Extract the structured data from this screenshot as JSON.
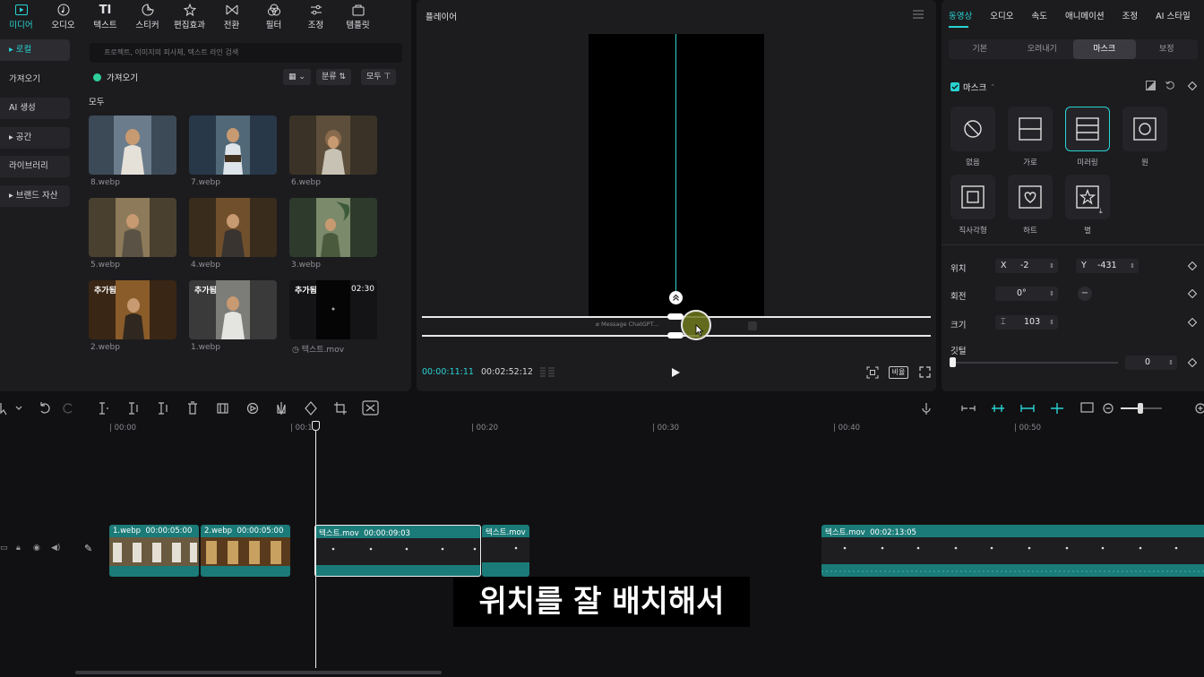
{
  "top_tools": [
    {
      "label": "미디어",
      "icon": "media-icon",
      "active": true
    },
    {
      "label": "오디오",
      "icon": "audio-icon"
    },
    {
      "label": "텍스트",
      "icon": "text-icon"
    },
    {
      "label": "스티커",
      "icon": "sticker-icon"
    },
    {
      "label": "편집효과",
      "icon": "effects-icon"
    },
    {
      "label": "전환",
      "icon": "transition-icon"
    },
    {
      "label": "필터",
      "icon": "filter-icon"
    },
    {
      "label": "조정",
      "icon": "adjust-icon"
    },
    {
      "label": "템플릿",
      "icon": "template-icon"
    }
  ],
  "side_nav": [
    "▸ 로컬",
    "가져오기",
    "AI 생성",
    "▸ 공간",
    "라이브러리",
    "▸ 브랜드 자산"
  ],
  "media": {
    "search_placeholder": "프로젝트, 이미지의 피사체, 텍스트 라인 검색",
    "import_label": "가져오기",
    "sort_label": "분류",
    "filter_label": "모두",
    "section_label": "모두",
    "items": [
      {
        "name": "8.webp"
      },
      {
        "name": "7.webp"
      },
      {
        "name": "6.webp"
      },
      {
        "name": "5.webp"
      },
      {
        "name": "4.webp"
      },
      {
        "name": "3.webp"
      },
      {
        "name": "2.webp",
        "badge": "추가됨"
      },
      {
        "name": "1.webp",
        "badge": "추가됨"
      },
      {
        "name": "텍스트.mov",
        "badge": "추가됨",
        "duration": "02:30"
      }
    ]
  },
  "player": {
    "title": "플레이어",
    "time_current": "00:00:11:11",
    "time_total": "00:02:52:12",
    "ratio_label": "비율",
    "overlay_text": "Message ChatGPT..."
  },
  "inspector": {
    "tabs": [
      "동영상",
      "오디오",
      "속도",
      "애니메이션",
      "조정",
      "AI 스타일"
    ],
    "sub_tabs": [
      "기본",
      "오려내기",
      "마스크",
      "보정"
    ],
    "mask_title": "마스크",
    "shapes": [
      "없음",
      "가로",
      "미러링",
      "원",
      "직사각형",
      "하트",
      "별"
    ],
    "position_label": "위치",
    "x_label": "X",
    "x_value": "-2",
    "y_label": "Y",
    "y_value": "-431",
    "rotation_label": "회전",
    "rotation_value": "0°",
    "size_label": "크기",
    "size_value": "103",
    "feather_label": "깃털",
    "feather_value": "0"
  },
  "timeline": {
    "ruler": [
      "00:00",
      "00:10",
      "00:20",
      "00:30",
      "00:40",
      "00:50"
    ],
    "clips": [
      {
        "title": "1.webp",
        "duration": "00:00:05:00"
      },
      {
        "title": "2.webp",
        "duration": "00:00:05:00"
      },
      {
        "title": "텍스트.mov",
        "duration": "00:00:09:03"
      },
      {
        "title": "텍스트.mov",
        "duration": ""
      },
      {
        "title": "텍스트.mov",
        "duration": "00:02:13:05"
      }
    ]
  },
  "subtitle": "위치를 잘 배치해서"
}
